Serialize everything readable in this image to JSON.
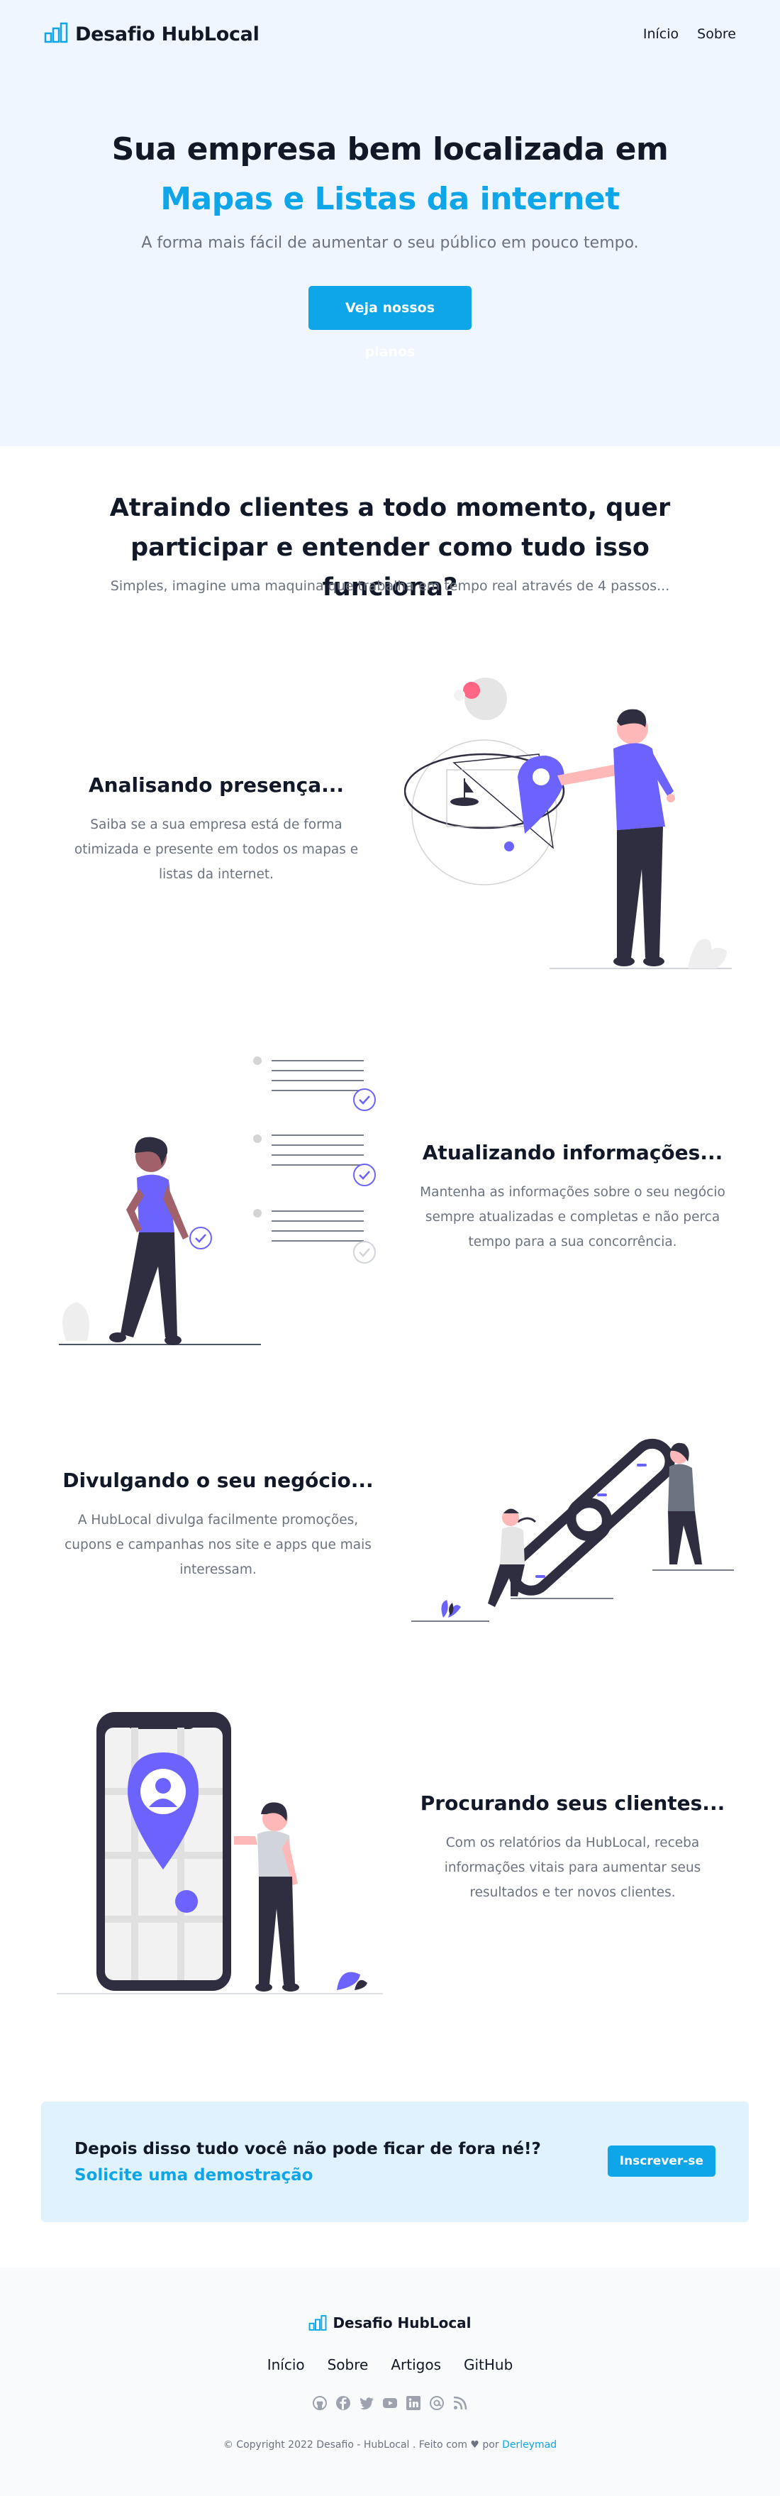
{
  "header": {
    "brand": "Desafio HubLocal",
    "nav": [
      {
        "label": "Início"
      },
      {
        "label": "Sobre"
      }
    ]
  },
  "hero": {
    "title_line1": "Sua empresa bem localizada em",
    "title_line2": "Mapas e Listas da internet",
    "subtitle": "A forma mais fácil de aumentar o seu público em pouco tempo.",
    "cta_label": "Veja nossos planos"
  },
  "steps_section": {
    "title": "Atraindo clientes a todo momento, quer participar e entender como tudo isso funciona?",
    "subtitle": "Simples, imagine uma maquina que trabalha em tempo real através de 4 passos..."
  },
  "features": [
    {
      "title": "Analisando presença...",
      "text": "Saiba se a sua empresa está de forma otimizada e presente em todos os mapas e listas da internet."
    },
    {
      "title": "Atualizando informações...",
      "text": "Mantenha as informações sobre o seu negócio sempre atualizadas e completas e não perca tempo para a sua concorrência."
    },
    {
      "title": "Divulgando o seu negócio...",
      "text": "A HubLocal divulga facilmente promoções, cupons e campanhas nos site e apps que mais interessam."
    },
    {
      "title": "Procurando seus clientes...",
      "text": "Com os relatórios da HubLocal, receba informações vitais para aumentar seus resultados e ter novos clientes."
    }
  ],
  "cta": {
    "question": "Depois disso tudo você não pode ficar de fora né!?",
    "link": "Solicite uma demostração",
    "button": "Inscrever-se"
  },
  "footer": {
    "brand": "Desafio HubLocal",
    "links": [
      {
        "label": "Início"
      },
      {
        "label": "Sobre"
      },
      {
        "label": "Artigos"
      },
      {
        "label": "GitHub"
      }
    ],
    "social_icons": [
      "github-icon",
      "facebook-icon",
      "twitter-icon",
      "youtube-icon",
      "linkedin-icon",
      "email-icon",
      "rss-icon"
    ],
    "copyright": "© Copyright 2022 Desafio - HubLocal . Feito com ♥ por",
    "author": "Derleymad"
  },
  "colors": {
    "accent": "#0ea5e9",
    "illustration_purple": "#6c63ff",
    "hero_bg": "#eff6ff",
    "cta_bg": "#e0f2fe"
  }
}
